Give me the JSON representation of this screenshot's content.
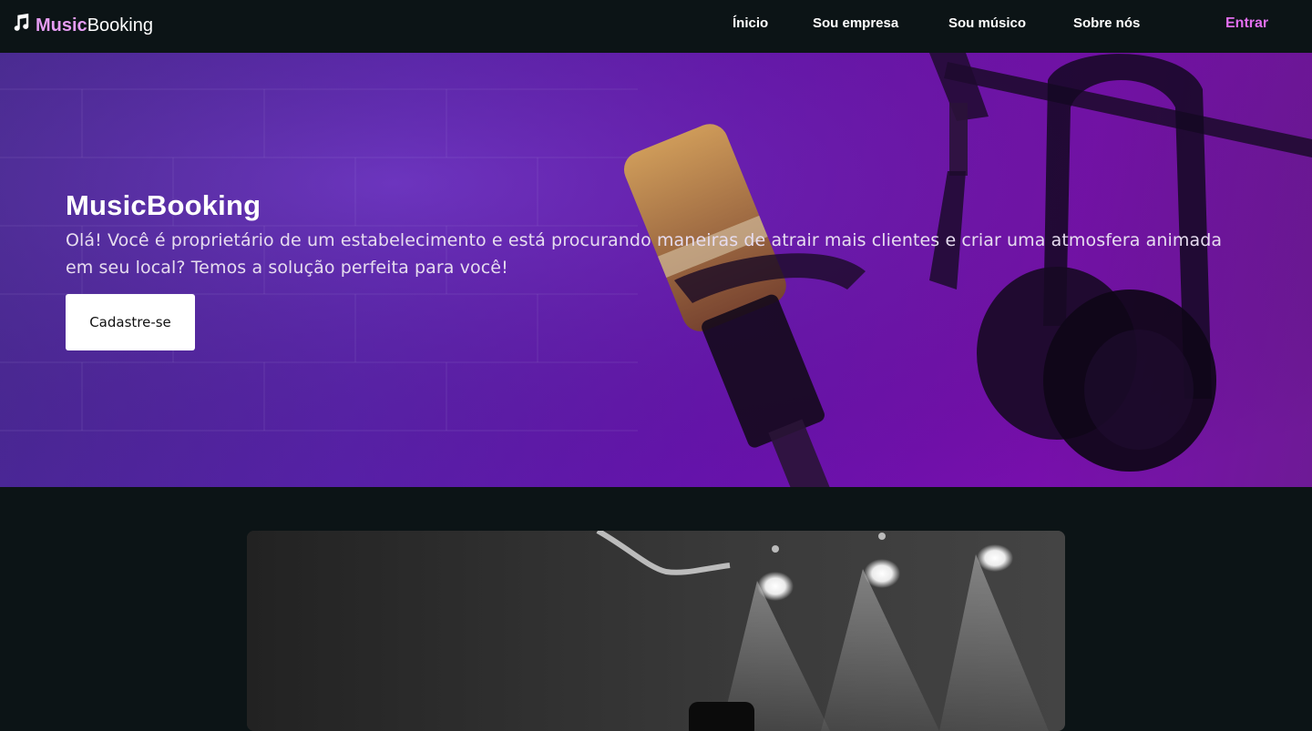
{
  "navbar": {
    "logo_music": "Music",
    "logo_booking": "Booking",
    "links": [
      "Ínicio",
      "Sou empresa",
      "Sou músico",
      "Sobre nós"
    ],
    "login": "Entrar"
  },
  "hero": {
    "title": "MusicBooking",
    "text": "Olá! Você é proprietário de um estabelecimento e está procurando maneiras de atrair mais clientes e criar uma atmosfera animada em seu local? Temos a solução perfeita para você!",
    "button": "Cadastre-se"
  },
  "colors": {
    "background": "#0c1416",
    "accent": "#e26ff0",
    "hero_purple": "#6a13b4"
  },
  "icons": {
    "logo": "music-note-icon"
  }
}
